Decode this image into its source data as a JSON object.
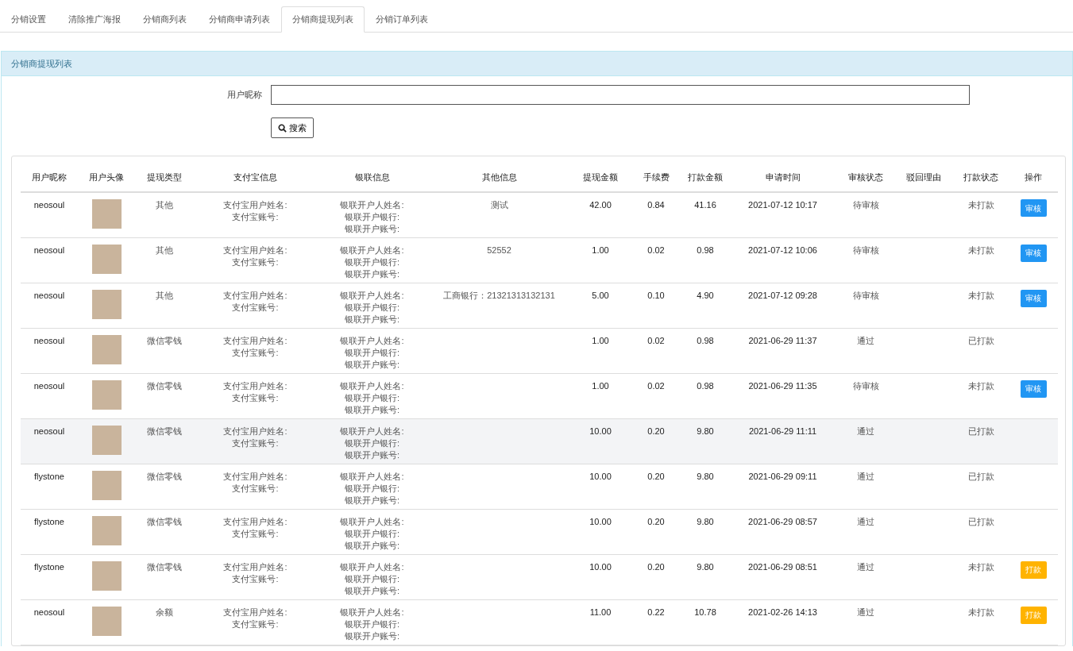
{
  "tabs": [
    {
      "label": "分销设置",
      "selected": false
    },
    {
      "label": "清除推广海报",
      "selected": false
    },
    {
      "label": "分销商列表",
      "selected": false
    },
    {
      "label": "分销商申请列表",
      "selected": false
    },
    {
      "label": "分销商提现列表",
      "selected": true
    },
    {
      "label": "分销订单列表",
      "selected": false
    }
  ],
  "panel": {
    "title": "分销商提现列表"
  },
  "search": {
    "label": "用户昵称",
    "button": "搜索"
  },
  "table": {
    "columns": [
      "用户昵称",
      "用户头像",
      "提现类型",
      "支付宝信息",
      "银联信息",
      "其他信息",
      "提现金额",
      "手续费",
      "打款金额",
      "申请时间",
      "审核状态",
      "驳回理由",
      "打款状态",
      "操作"
    ],
    "rows": [
      {
        "selected": false,
        "nickname": "neosoul",
        "type": "其他",
        "alipay": [
          "支付宝用户姓名:",
          "支付宝账号:"
        ],
        "bank": [
          "银联开户人姓名:",
          "银联开户银行:",
          "银联开户账号:"
        ],
        "other": "测试",
        "amount": "42.00",
        "fee": "0.84",
        "paid": "41.16",
        "time": "2021-07-12 10:17",
        "review": "待审核",
        "payment": "未打款",
        "action": {
          "kind": "review",
          "label": "审核"
        }
      },
      {
        "selected": false,
        "nickname": "neosoul",
        "type": "其他",
        "alipay": [
          "支付宝用户姓名:",
          "支付宝账号:"
        ],
        "bank": [
          "银联开户人姓名:",
          "银联开户银行:",
          "银联开户账号:"
        ],
        "other": "52552",
        "amount": "1.00",
        "fee": "0.02",
        "paid": "0.98",
        "time": "2021-07-12 10:06",
        "review": "待审核",
        "payment": "未打款",
        "action": {
          "kind": "review",
          "label": "审核"
        }
      },
      {
        "selected": false,
        "nickname": "neosoul",
        "type": "其他",
        "alipay": [
          "支付宝用户姓名:",
          "支付宝账号:"
        ],
        "bank": [
          "银联开户人姓名:",
          "银联开户银行:",
          "银联开户账号:"
        ],
        "other": "工商银行：21321313132131",
        "amount": "5.00",
        "fee": "0.10",
        "paid": "4.90",
        "time": "2021-07-12 09:28",
        "review": "待审核",
        "payment": "未打款",
        "action": {
          "kind": "review",
          "label": "审核"
        }
      },
      {
        "selected": false,
        "nickname": "neosoul",
        "type": "微信零钱",
        "alipay": [
          "支付宝用户姓名:",
          "支付宝账号:"
        ],
        "bank": [
          "银联开户人姓名:",
          "银联开户银行:",
          "银联开户账号:"
        ],
        "amount": "1.00",
        "fee": "0.02",
        "paid": "0.98",
        "time": "2021-06-29 11:37",
        "review": "通过",
        "payment": "已打款"
      },
      {
        "selected": false,
        "nickname": "neosoul",
        "type": "微信零钱",
        "alipay": [
          "支付宝用户姓名:",
          "支付宝账号:"
        ],
        "bank": [
          "银联开户人姓名:",
          "银联开户银行:",
          "银联开户账号:"
        ],
        "amount": "1.00",
        "fee": "0.02",
        "paid": "0.98",
        "time": "2021-06-29 11:35",
        "review": "待审核",
        "payment": "未打款",
        "action": {
          "kind": "review",
          "label": "审核"
        }
      },
      {
        "selected": true,
        "nickname": "neosoul",
        "type": "微信零钱",
        "alipay": [
          "支付宝用户姓名:",
          "支付宝账号:"
        ],
        "bank": [
          "银联开户人姓名:",
          "银联开户银行:",
          "银联开户账号:"
        ],
        "amount": "10.00",
        "fee": "0.20",
        "paid": "9.80",
        "time": "2021-06-29 11:11",
        "review": "通过",
        "payment": "已打款"
      },
      {
        "selected": false,
        "nickname": "flystone",
        "type": "微信零钱",
        "alipay": [
          "支付宝用户姓名:",
          "支付宝账号:"
        ],
        "bank": [
          "银联开户人姓名:",
          "银联开户银行:",
          "银联开户账号:"
        ],
        "amount": "10.00",
        "fee": "0.20",
        "paid": "9.80",
        "time": "2021-06-29 09:11",
        "review": "通过",
        "payment": "已打款"
      },
      {
        "selected": false,
        "nickname": "flystone",
        "type": "微信零钱",
        "alipay": [
          "支付宝用户姓名:",
          "支付宝账号:"
        ],
        "bank": [
          "银联开户人姓名:",
          "银联开户银行:",
          "银联开户账号:"
        ],
        "amount": "10.00",
        "fee": "0.20",
        "paid": "9.80",
        "time": "2021-06-29 08:57",
        "review": "通过",
        "payment": "已打款"
      },
      {
        "selected": false,
        "nickname": "flystone",
        "type": "微信零钱",
        "alipay": [
          "支付宝用户姓名:",
          "支付宝账号:"
        ],
        "bank": [
          "银联开户人姓名:",
          "银联开户银行:",
          "银联开户账号:"
        ],
        "amount": "10.00",
        "fee": "0.20",
        "paid": "9.80",
        "time": "2021-06-29 08:51",
        "review": "通过",
        "payment": "未打款",
        "action": {
          "kind": "pay",
          "label": "打款"
        }
      },
      {
        "selected": false,
        "nickname": "neosoul",
        "type": "余额",
        "alipay": [
          "支付宝用户姓名:",
          "支付宝账号:"
        ],
        "bank": [
          "银联开户人姓名:",
          "银联开户银行:",
          "银联开户账号:"
        ],
        "amount": "11.00",
        "fee": "0.22",
        "paid": "10.78",
        "time": "2021-02-26 14:13",
        "review": "通过",
        "payment": "未打款",
        "action": {
          "kind": "pay",
          "label": "打款"
        }
      }
    ]
  }
}
